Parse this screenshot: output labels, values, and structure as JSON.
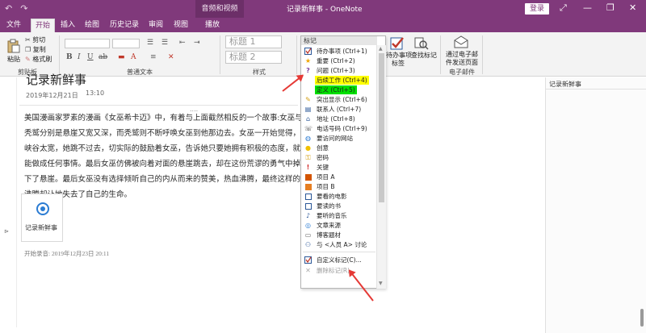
{
  "titlebar": {
    "context_tab": "音频和视频",
    "title": "记录新鲜事 - OneNote",
    "login": "登录",
    "undo": "↶",
    "redo": "↷",
    "minimize": "—",
    "restore": "❐",
    "close": "✕",
    "maximize": "⤢"
  },
  "tabs": [
    "文件",
    "开始",
    "插入",
    "绘图",
    "历史记录",
    "审阅",
    "视图",
    "播放"
  ],
  "ribbon": {
    "paste": "粘贴",
    "cut": "剪切",
    "copy": "复制",
    "format_painter": "格式刷",
    "clipboard_group": "剪贴板",
    "basic_text_group": "普通文本",
    "styles_group": "样式",
    "heading1": "标题 1",
    "heading2": "标题 2",
    "bold": "B",
    "italic": "I",
    "underline": "U",
    "strike": "ab",
    "todo_tag": "待办事项",
    "todo_tag2": "标签",
    "find_tags": "查找标记",
    "email_page1": "通过电子邮",
    "email_page2": "件发送页面",
    "email_group": "电子邮件"
  },
  "page": {
    "heading": "记录新鲜事",
    "date": "2019年12月21日",
    "time": "13:10",
    "paragraph": "美国漫画家罗素的漫画《女巫希卡迈》中，有着与上面截然相反的一个故事:女巫与秃鹫分别是悬崖又宽又深，而秃鹫则不断呼唤女巫到他那边去。女巫一开始觉得，峡谷太宽，她跳不过去，切实际的鼓励着女巫，告诉她只要她拥有积极的态度，就能做成任何事情。最后女巫仿佛被向着对面的悬崖跳去，却在这份荒谬的勇气中掉下了悬崖。最后女巫没有选择倾听自己的内从而来的赞美，热血沸腾，最终这样的沸腾却让她失去了自己的生命。",
    "attachment_label": "记录新鲜事",
    "record_start": "开始录音: 2019年12月23日 20:11",
    "dots": "....",
    "left_marker": "⊳"
  },
  "right_pane": {
    "page_name": "记录新鲜事"
  },
  "tag_menu": {
    "header": "标记",
    "items": [
      {
        "icon": "checkbox-icon",
        "label": "待办事项 (Ctrl+1)"
      },
      {
        "icon": "star-icon",
        "label": "重要 (Ctrl+2)"
      },
      {
        "icon": "question-icon",
        "label": "问题 (Ctrl+3)"
      },
      {
        "icon": "none",
        "label": "后续工作 (Ctrl+4)",
        "highlight": "#ffff00"
      },
      {
        "icon": "none",
        "label": "定义 (Ctrl+5)",
        "highlight": "#00e000"
      },
      {
        "icon": "pen-icon",
        "label": "突出显示 (Ctrl+6)"
      },
      {
        "icon": "contact-icon",
        "label": "联系人 (Ctrl+7)"
      },
      {
        "icon": "home-icon",
        "label": "地址 (Ctrl+8)"
      },
      {
        "icon": "phone-icon",
        "label": "电话号码 (Ctrl+9)"
      },
      {
        "icon": "globe-icon",
        "label": "要访问的网站"
      },
      {
        "icon": "bulb-icon",
        "label": "创意"
      },
      {
        "icon": "key-icon",
        "label": "密码"
      },
      {
        "icon": "exclamation-icon",
        "label": "关键"
      },
      {
        "icon": "square-a-icon",
        "label": "项目 A"
      },
      {
        "icon": "square-b-icon",
        "label": "项目 B"
      },
      {
        "icon": "film-icon",
        "label": "要看的电影"
      },
      {
        "icon": "book-icon",
        "label": "要读的书"
      },
      {
        "icon": "music-icon",
        "label": "要听的音乐"
      },
      {
        "icon": "source-icon",
        "label": "文章来源"
      },
      {
        "icon": "chat-icon",
        "label": "博客题材"
      },
      {
        "icon": "people-icon",
        "label": "与 <人员 A> 讨论"
      },
      {
        "icon": "custom-tag-icon",
        "label": "自定义标记(C)..."
      },
      {
        "icon": "remove-tag-icon",
        "label": "删除标记(R)",
        "disabled": true
      }
    ]
  },
  "colors": {
    "brand": "#80397b",
    "arrow": "#e53935",
    "project_a": "#d35400",
    "project_b": "#e67e22"
  }
}
